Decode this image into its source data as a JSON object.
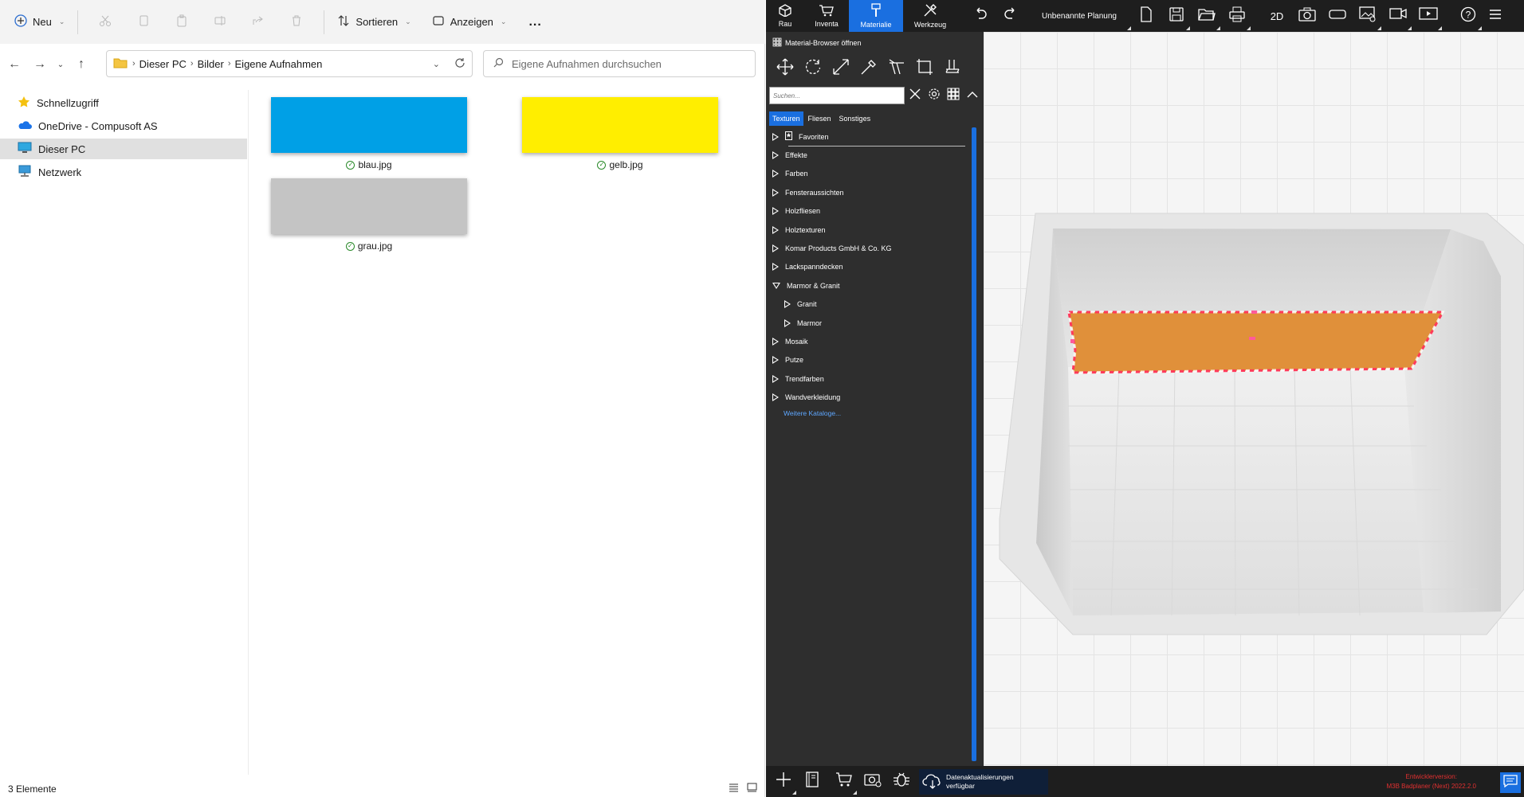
{
  "explorer": {
    "commandbar": {
      "new_label": "Neu",
      "sort_label": "Sortieren",
      "view_label": "Anzeigen",
      "more_label": "..."
    },
    "address": {
      "crumbs": [
        "Dieser PC",
        "Bilder",
        "Eigene Aufnahmen"
      ]
    },
    "search_placeholder": "Eigene Aufnahmen durchsuchen",
    "nav": [
      {
        "label": "Schnellzugriff",
        "icon": "star-icon"
      },
      {
        "label": "OneDrive - Compusoft AS",
        "icon": "cloud-icon"
      },
      {
        "label": "Dieser PC",
        "icon": "computer-icon",
        "selected": true
      },
      {
        "label": "Netzwerk",
        "icon": "network-icon"
      }
    ],
    "files": [
      {
        "name": "blau.jpg",
        "color": "#00a0e6"
      },
      {
        "name": "gelb.jpg",
        "color": "#ffee00"
      },
      {
        "name": "grau.jpg",
        "color": "#c4c4c4"
      }
    ],
    "status": "3 Elemente"
  },
  "planner": {
    "tabs": [
      {
        "label": "Rau",
        "icon": "room-icon"
      },
      {
        "label": "Inventa",
        "icon": "cart-icon"
      },
      {
        "label": "Materialie",
        "icon": "brush-icon",
        "active": true
      },
      {
        "label": "Werkzeug",
        "icon": "tools-icon"
      }
    ],
    "plan_name": "Unbenannte Planung",
    "view2d_label": "2D",
    "material_browser": {
      "open_label": "Material-Browser öffnen",
      "search_placeholder": "Suchen...",
      "tabs": [
        "Texturen",
        "Fliesen",
        "Sonstiges"
      ],
      "active_tab": "Texturen",
      "tree": [
        {
          "label": "Favoriten",
          "level": 0,
          "open": false,
          "favorite": true
        },
        {
          "label": "Effekte",
          "level": 0
        },
        {
          "label": "Farben",
          "level": 0
        },
        {
          "label": "Fensteraussichten",
          "level": 0
        },
        {
          "label": "Holzfliesen",
          "level": 0
        },
        {
          "label": "Holztexturen",
          "level": 0
        },
        {
          "label": "Komar Products GmbH & Co. KG",
          "level": 0
        },
        {
          "label": "Lackspanndecken",
          "level": 0
        },
        {
          "label": "Marmor & Granit",
          "level": 0,
          "open": true
        },
        {
          "label": "Granit",
          "level": 1
        },
        {
          "label": "Marmor",
          "level": 1
        },
        {
          "label": "Mosaik",
          "level": 0
        },
        {
          "label": "Putze",
          "level": 0
        },
        {
          "label": "Trendfarben",
          "level": 0
        },
        {
          "label": "Wandverkleidung",
          "level": 0
        }
      ],
      "more_catalogs": "Weitere Kataloge..."
    },
    "viewport": {
      "selected_wall_color": "#e0903a",
      "selection_outline_color": "#ff3a5a"
    },
    "bottom": {
      "update_label": "Datenaktualisierungen verfügbar",
      "dev_version_line1": "Entwicklerversion:",
      "dev_version_line2": "M3B Badplaner (Next) 2022.2.0"
    }
  }
}
